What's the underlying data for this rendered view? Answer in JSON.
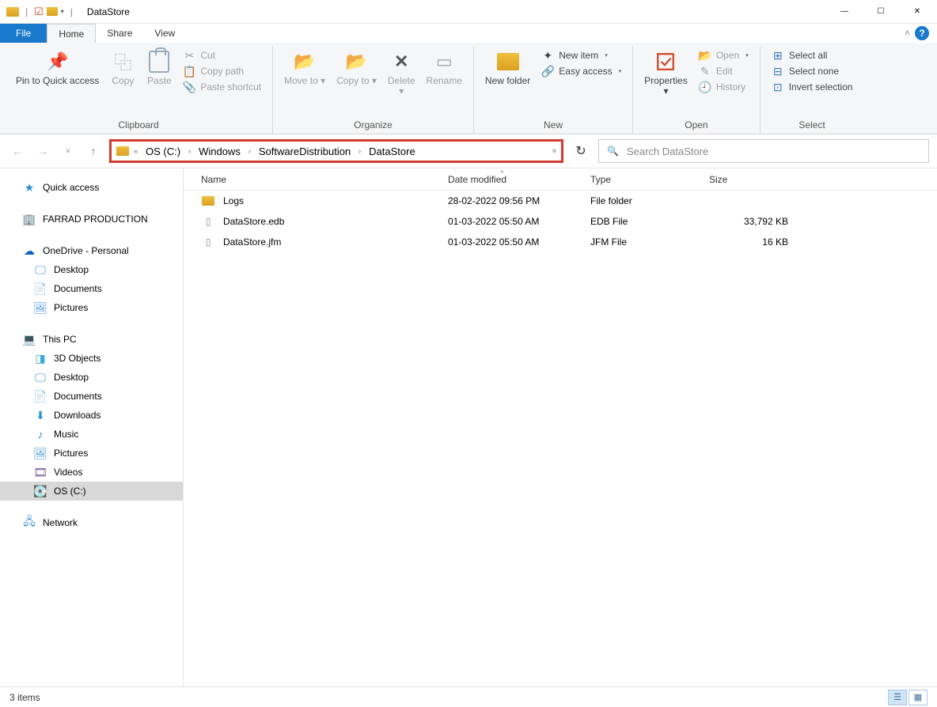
{
  "title": "DataStore",
  "tabs": {
    "file": "File",
    "home": "Home",
    "share": "Share",
    "view": "View"
  },
  "ribbon": {
    "clipboard": {
      "label": "Clipboard",
      "pin": "Pin to Quick access",
      "copy": "Copy",
      "paste": "Paste",
      "cut": "Cut",
      "copypath": "Copy path",
      "pasteshortcut": "Paste shortcut"
    },
    "organize": {
      "label": "Organize",
      "moveto": "Move to",
      "copyto": "Copy to",
      "delete": "Delete",
      "rename": "Rename"
    },
    "new": {
      "label": "New",
      "newfolder": "New folder",
      "newitem": "New item",
      "easyaccess": "Easy access"
    },
    "open": {
      "label": "Open",
      "properties": "Properties",
      "open": "Open",
      "edit": "Edit",
      "history": "History"
    },
    "select": {
      "label": "Select",
      "selectall": "Select all",
      "selectnone": "Select none",
      "invert": "Invert selection"
    }
  },
  "breadcrumb": [
    "OS (C:)",
    "Windows",
    "SoftwareDistribution",
    "DataStore"
  ],
  "search_placeholder": "Search DataStore",
  "sidebar": {
    "quick": "Quick access",
    "farrad": "FARRAD PRODUCTION",
    "onedrive": "OneDrive - Personal",
    "onedrive_children": [
      "Desktop",
      "Documents",
      "Pictures"
    ],
    "thispc": "This PC",
    "thispc_children": [
      "3D Objects",
      "Desktop",
      "Documents",
      "Downloads",
      "Music",
      "Pictures",
      "Videos",
      "OS (C:)"
    ],
    "network": "Network"
  },
  "columns": {
    "name": "Name",
    "date": "Date modified",
    "type": "Type",
    "size": "Size"
  },
  "files": [
    {
      "name": "Logs",
      "date": "28-02-2022 09:56 PM",
      "type": "File folder",
      "size": "",
      "kind": "folder"
    },
    {
      "name": "DataStore.edb",
      "date": "01-03-2022 05:50 AM",
      "type": "EDB File",
      "size": "33,792 KB",
      "kind": "file"
    },
    {
      "name": "DataStore.jfm",
      "date": "01-03-2022 05:50 AM",
      "type": "JFM File",
      "size": "16 KB",
      "kind": "file"
    }
  ],
  "status": "3 items"
}
